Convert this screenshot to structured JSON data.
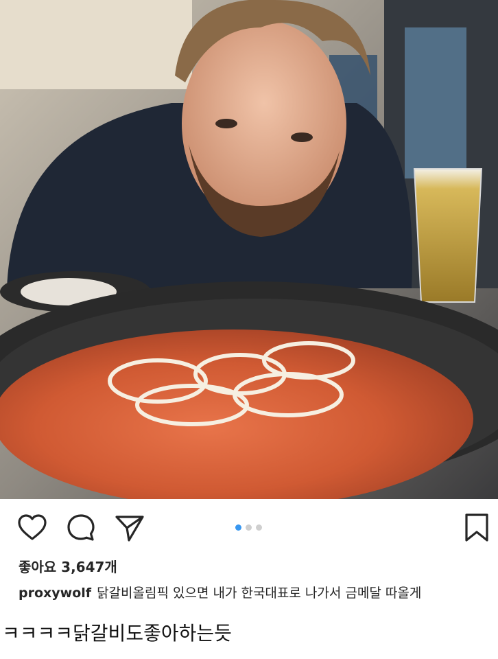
{
  "post": {
    "photo_description": "Man with beard leaning over a pan of spicy chicken galbi with onion rings; glass of beer on the right",
    "carousel": {
      "current_index": 1,
      "total": 3
    },
    "likes_label": "좋아요 3,647개",
    "caption": {
      "username": "proxywolf",
      "text": "닭갈비올림픽 있으면 내가 한국대표로 나가서 금메달 따올게"
    }
  },
  "actions": {
    "like_icon": "heart-outline-icon",
    "comment_icon": "speech-bubble-icon",
    "share_icon": "paper-plane-icon",
    "save_icon": "bookmark-icon"
  },
  "overlay_comment": "ㅋㅋㅋㅋ닭갈비도좋아하는듯",
  "colors": {
    "accent_dot": "#3897f0",
    "inactive_dot": "#cfcfcf",
    "text": "#262626"
  }
}
